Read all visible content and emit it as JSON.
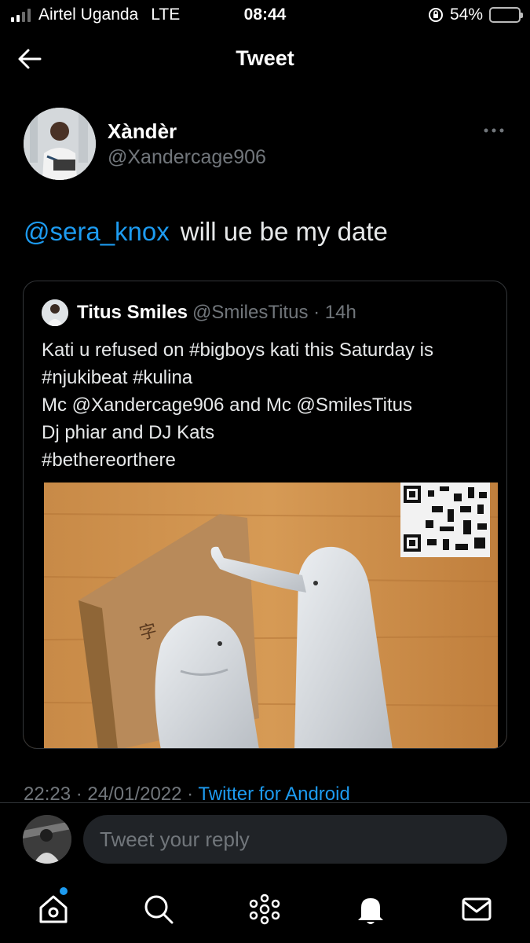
{
  "status_bar": {
    "carrier": "Airtel Uganda",
    "network": "LTE",
    "time": "08:44",
    "battery": "54%",
    "battery_color": "#ffd60a"
  },
  "header": {
    "title": "Tweet",
    "back_icon": "arrow-left-icon"
  },
  "tweet": {
    "author_name": "Xàndèr",
    "author_handle": "@Xandercage906",
    "mention": "@sera_knox",
    "text": "will ue be my date",
    "timestamp": "22:23 · 24/01/2022 · ",
    "client": "Twitter for Android"
  },
  "quote": {
    "name": "Titus Smiles",
    "handle": "@SmilesTitus · 14h",
    "lines": [
      "Kati u refused on #bigboys kati this Saturday is",
      "#njukibeat #kulina",
      "Mc @Xandercage906 and Mc @SmilesTitus",
      "Dj phiar and DJ Kats",
      "#bethereorthere"
    ]
  },
  "reply": {
    "placeholder": "Tweet your reply"
  },
  "nav": [
    "home-icon",
    "search-icon",
    "spaces-icon",
    "notifications-icon",
    "messages-icon"
  ],
  "colors": {
    "accent": "#1d9bf0",
    "background": "#000000",
    "muted_text": "#71767b"
  }
}
